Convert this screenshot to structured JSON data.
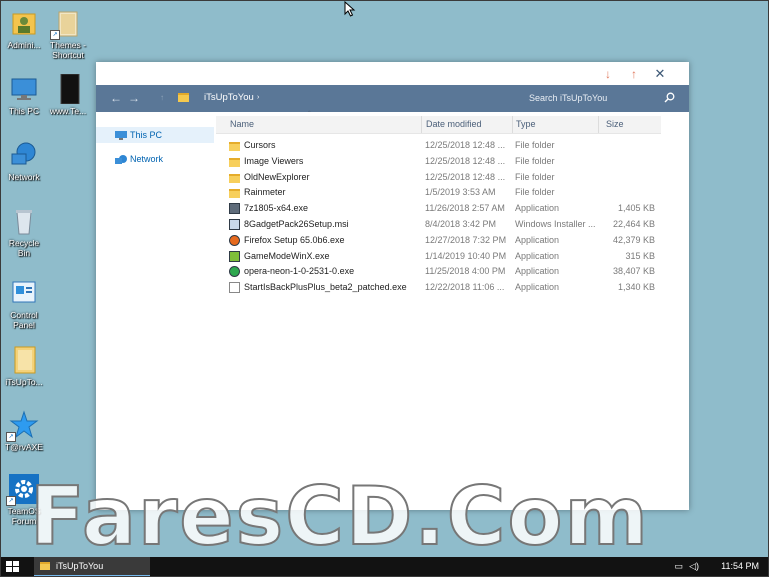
{
  "desktop": {
    "icons": [
      {
        "label": "Admini...",
        "icon": "user-folder-icon"
      },
      {
        "label": "Themes - Shortcut",
        "icon": "folder-shortcut-icon"
      },
      {
        "label": "This PC",
        "icon": "computer-icon"
      },
      {
        "label": "www.Te...",
        "icon": "file-icon"
      },
      {
        "label": "Network",
        "icon": "network-globe-icon"
      },
      {
        "label": "Recycle Bin",
        "icon": "recycle-bin-icon"
      },
      {
        "label": "Control Panel",
        "icon": "control-panel-icon"
      },
      {
        "label": "iTsUpTo...",
        "icon": "folder-icon"
      },
      {
        "label": "T@rvAXE",
        "icon": "star-shortcut-icon"
      },
      {
        "label": "TeamOS Forum",
        "icon": "gear-shortcut-icon"
      }
    ]
  },
  "window": {
    "breadcrumb": "iTsUpToYou",
    "search_placeholder": "Search iTsUpToYou",
    "nav_pane": [
      {
        "label": "This PC",
        "selected": true
      },
      {
        "label": "Network",
        "selected": false
      }
    ],
    "columns": [
      "Name",
      "Date modified",
      "Type",
      "Size"
    ],
    "files": [
      {
        "name": "Cursors",
        "date": "12/25/2018 12:48 ...",
        "type": "File folder",
        "size": "",
        "kind": "folder"
      },
      {
        "name": "Image Viewers",
        "date": "12/25/2018 12:48 ...",
        "type": "File folder",
        "size": "",
        "kind": "folder"
      },
      {
        "name": "OldNewExplorer",
        "date": "12/25/2018 12:48 ...",
        "type": "File folder",
        "size": "",
        "kind": "folder"
      },
      {
        "name": "Rainmeter",
        "date": "1/5/2019 3:53 AM",
        "type": "File folder",
        "size": "",
        "kind": "folder"
      },
      {
        "name": "7z1805-x64.exe",
        "date": "11/26/2018 2:57 AM",
        "type": "Application",
        "size": "1,405 KB",
        "kind": "exe"
      },
      {
        "name": "8GadgetPack26Setup.msi",
        "date": "8/4/2018 3:42 PM",
        "type": "Windows Installer ...",
        "size": "22,464 KB",
        "kind": "msi"
      },
      {
        "name": "Firefox Setup 65.0b6.exe",
        "date": "12/27/2018 7:32 PM",
        "type": "Application",
        "size": "42,379 KB",
        "kind": "firefox"
      },
      {
        "name": "GameModeWinX.exe",
        "date": "1/14/2019 10:40 PM",
        "type": "Application",
        "size": "315 KB",
        "kind": "gamemode"
      },
      {
        "name": "opera-neon-1-0-2531-0.exe",
        "date": "11/25/2018 4:00 PM",
        "type": "Application",
        "size": "38,407 KB",
        "kind": "opera"
      },
      {
        "name": "StartIsBackPlusPlus_beta2_patched.exe",
        "date": "12/22/2018 11:06 ...",
        "type": "Application",
        "size": "1,340 KB",
        "kind": "startisback"
      }
    ]
  },
  "taskbar": {
    "item": "iTsUpToYou",
    "clock": "11:54 PM"
  },
  "watermark": "FaresCD.Com",
  "colors": {
    "desktop": "#8fbccb",
    "navbar": "#5a7797",
    "taskbar": "#121212"
  }
}
